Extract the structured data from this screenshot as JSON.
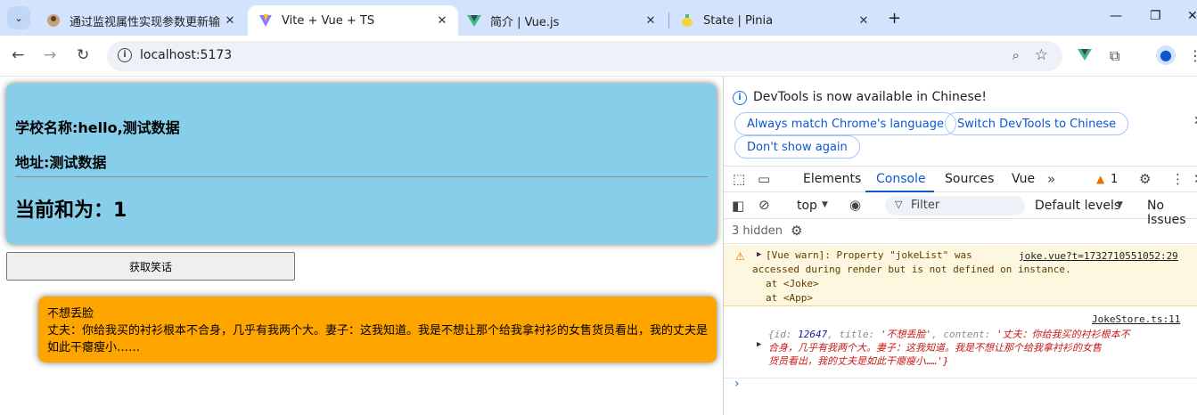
{
  "browser": {
    "tabs": [
      {
        "title": "通过监视属性实现参数更新输出",
        "active": false
      },
      {
        "title": "Vite + Vue + TS",
        "active": true
      },
      {
        "title": "简介 | Vue.js",
        "active": false
      },
      {
        "title": "State | Pinia",
        "active": false
      }
    ],
    "url": "localhost:5173"
  },
  "app": {
    "school_name": "学校名称:hello,测试数据",
    "address": "地址:测试数据",
    "sum_text": "当前和为：1",
    "joke_button": "获取笑话",
    "joke_title": "不想丢脸",
    "joke_content": "丈夫：你给我买的衬衫根本不合身，几乎有我两个大。妻子：这我知道。我是不想让那个给我拿衬衫的女售货员看出，我的丈夫是如此干瘪瘦小……"
  },
  "devtools": {
    "info_message": "DevTools is now available in Chinese!",
    "btn_match": "Always match Chrome's language",
    "btn_switch": "Switch DevTools to Chinese",
    "btn_dont_show": "Don't show again",
    "tabs": [
      "Elements",
      "Console",
      "Sources",
      "Vue"
    ],
    "active_tab": "Console",
    "issue_count": "1",
    "context": "top",
    "filter_placeholder": "Filter",
    "levels": "Default levels",
    "no_issues": "No Issues",
    "hidden": "3 hidden",
    "warning": {
      "line1": "[Vue warn]: Property \"jokeList\" was",
      "line2": "accessed during render but is not defined on instance.",
      "line3": "at <Joke>",
      "line4": "at <App>",
      "source": "joke.vue?t=1732710551052:29"
    },
    "log": {
      "source": "JokeStore.ts:11",
      "id_label": "{id: ",
      "id_value": "12647",
      "title_label": ", title: ",
      "title_value": "'不想丢脸'",
      "content_label": ", content: ",
      "content_value_1": "'丈夫：你给我买的衬衫根本不",
      "content_value_2": "合身，几乎有我两个大。妻子：这我知道。我是不想让那个给我拿衬衫的女售",
      "content_value_3": "货员看出，我的丈夫是如此干瘪瘦小……'}"
    }
  }
}
